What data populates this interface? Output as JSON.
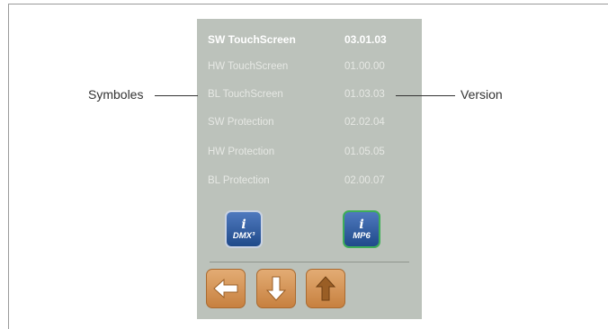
{
  "callouts": {
    "left_label": "Symboles",
    "right_label": "Version"
  },
  "screen": {
    "rows": [
      {
        "name": "SW TouchScreen",
        "version": "03.01.03",
        "highlighted": true
      },
      {
        "name": "HW TouchScreen",
        "version": "01.00.00",
        "highlighted": false
      },
      {
        "name": "BL TouchScreen",
        "version": "01.03.03",
        "highlighted": false
      },
      {
        "name": "SW Protection",
        "version": "02.02.04",
        "highlighted": false
      },
      {
        "name": "HW Protection",
        "version": "01.05.05",
        "highlighted": false
      },
      {
        "name": "BL Protection",
        "version": "02.00.07",
        "highlighted": false
      }
    ],
    "icons": [
      {
        "glyph": "i",
        "label": "DMX³",
        "icon": "info-dmx3-icon"
      },
      {
        "glyph": "i",
        "label": "MP6",
        "icon": "info-mp6-icon"
      }
    ],
    "nav_buttons": [
      {
        "icon": "arrow-left-icon"
      },
      {
        "icon": "arrow-down-icon"
      },
      {
        "icon": "arrow-up-icon"
      }
    ]
  },
  "colors": {
    "screen_bg": "#bcc2bb",
    "button_orange": "#d48f4f",
    "icon_blue": "#2d5aa0",
    "mp6_border": "#3fae58"
  }
}
